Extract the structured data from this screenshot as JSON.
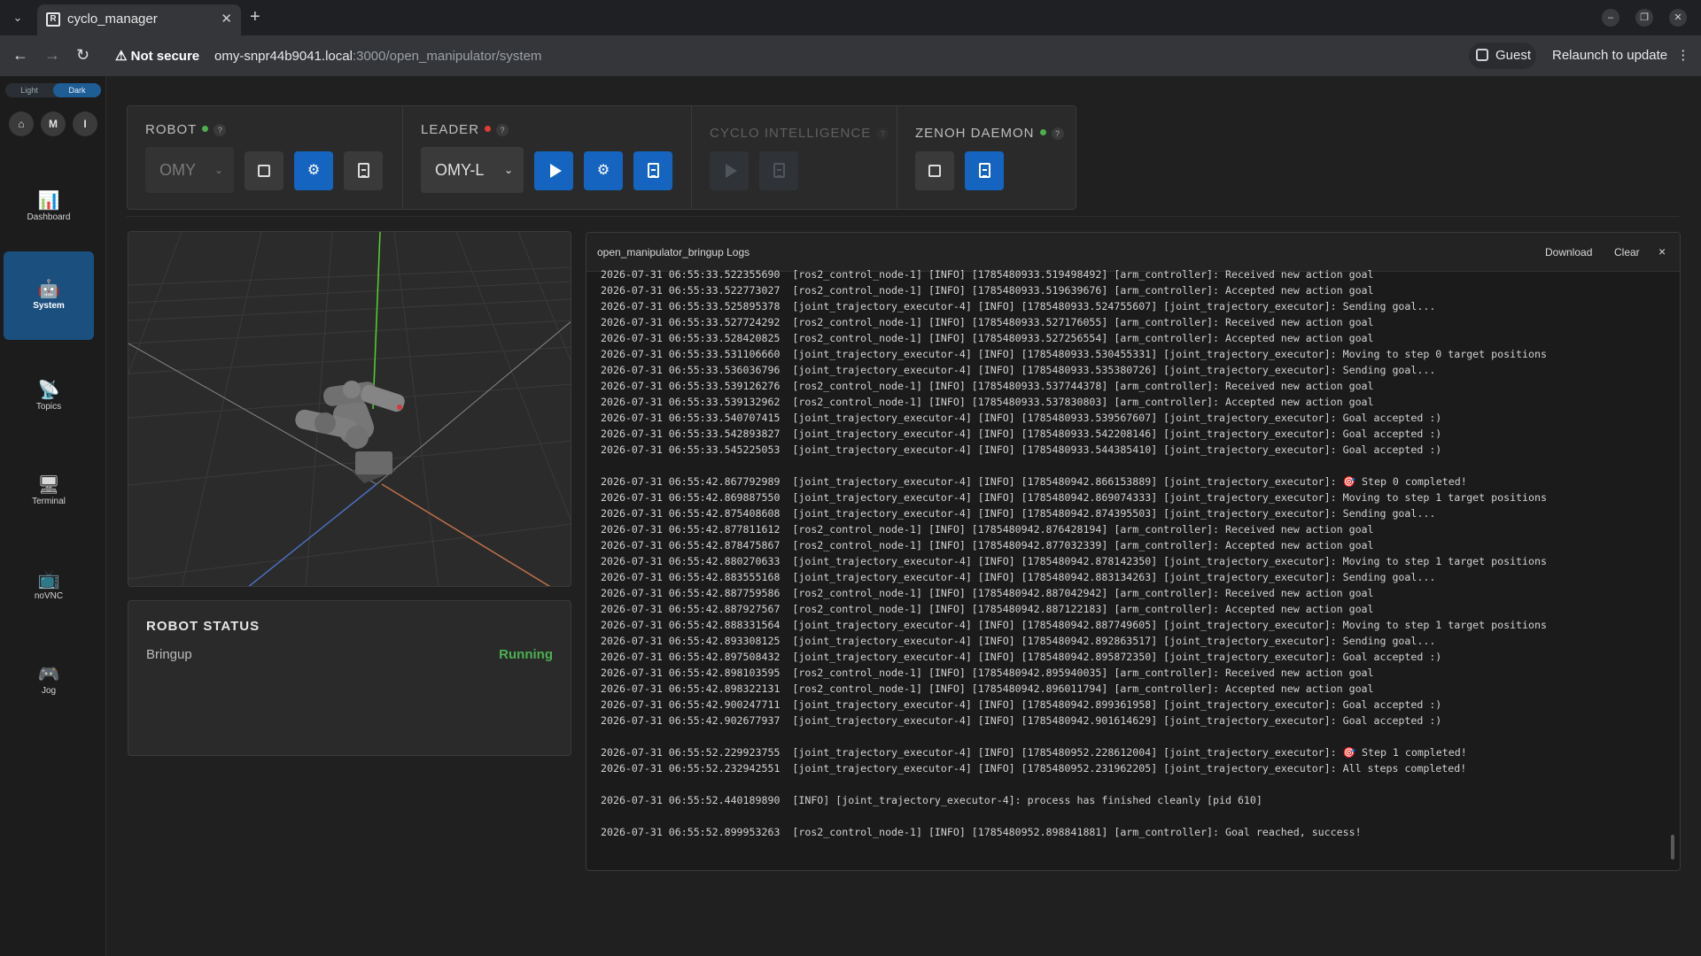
{
  "browser": {
    "tab_title": "cyclo_manager",
    "security": "Not secure",
    "url_host": "omy-snpr44b9041.local",
    "url_path": ":3000/open_manipulator/system",
    "guest_label": "Guest",
    "relaunch_label": "Relaunch to update"
  },
  "sidebar": {
    "theme": {
      "light": "Light",
      "dark": "Dark",
      "active": "Dark"
    },
    "quick": [
      "M",
      "I"
    ],
    "items": [
      {
        "label": "Dashboard",
        "icon": "📊"
      },
      {
        "label": "System",
        "icon": "🤖"
      },
      {
        "label": "Topics",
        "icon": "📡"
      },
      {
        "label": "Terminal",
        "icon": "🖥"
      },
      {
        "label": "noVNC",
        "icon": "📺"
      },
      {
        "label": "Jog",
        "icon": "🎮"
      }
    ]
  },
  "controls": {
    "robot": {
      "title": "ROBOT",
      "status_color": "#4caf50",
      "select": "OMY"
    },
    "leader": {
      "title": "LEADER",
      "status_color": "#e53935",
      "select": "OMY-L"
    },
    "cyclo": {
      "title": "CYCLO INTELLIGENCE"
    },
    "zenoh": {
      "title": "ZENOH DAEMON",
      "status_color": "#4caf50"
    },
    "help": "?"
  },
  "robot_status": {
    "title": "ROBOT STATUS",
    "key": "Bringup",
    "value": "Running",
    "value_color": "#4caf50"
  },
  "logs": {
    "title": "open_manipulator_bringup Logs",
    "download_label": "Download",
    "clear_label": "Clear",
    "close_label": "×",
    "lines": [
      "2026-07-31 06:55:33.522355690  [ros2_control_node-1] [INFO] [1785480933.519498492] [arm_controller]: Received new action goal",
      "2026-07-31 06:55:33.522773027  [ros2_control_node-1] [INFO] [1785480933.519639676] [arm_controller]: Accepted new action goal",
      "2026-07-31 06:55:33.525895378  [joint_trajectory_executor-4] [INFO] [1785480933.524755607] [joint_trajectory_executor]: Sending goal...",
      "2026-07-31 06:55:33.527724292  [ros2_control_node-1] [INFO] [1785480933.527176055] [arm_controller]: Received new action goal",
      "2026-07-31 06:55:33.528420825  [ros2_control_node-1] [INFO] [1785480933.527256554] [arm_controller]: Accepted new action goal",
      "2026-07-31 06:55:33.531106660  [joint_trajectory_executor-4] [INFO] [1785480933.530455331] [joint_trajectory_executor]: Moving to step 0 target positions",
      "2026-07-31 06:55:33.536036796  [joint_trajectory_executor-4] [INFO] [1785480933.535380726] [joint_trajectory_executor]: Sending goal...",
      "2026-07-31 06:55:33.539126276  [ros2_control_node-1] [INFO] [1785480933.537744378] [arm_controller]: Received new action goal",
      "2026-07-31 06:55:33.539132962  [ros2_control_node-1] [INFO] [1785480933.537830803] [arm_controller]: Accepted new action goal",
      "2026-07-31 06:55:33.540707415  [joint_trajectory_executor-4] [INFO] [1785480933.539567607] [joint_trajectory_executor]: Goal accepted :)",
      "2026-07-31 06:55:33.542893827  [joint_trajectory_executor-4] [INFO] [1785480933.542208146] [joint_trajectory_executor]: Goal accepted :)",
      "2026-07-31 06:55:33.545225053  [joint_trajectory_executor-4] [INFO] [1785480933.544385410] [joint_trajectory_executor]: Goal accepted :)",
      "",
      "2026-07-31 06:55:42.867792989  [joint_trajectory_executor-4] [INFO] [1785480942.866153889] [joint_trajectory_executor]: 🎯 Step 0 completed!",
      "2026-07-31 06:55:42.869887550  [joint_trajectory_executor-4] [INFO] [1785480942.869074333] [joint_trajectory_executor]: Moving to step 1 target positions",
      "2026-07-31 06:55:42.875408608  [joint_trajectory_executor-4] [INFO] [1785480942.874395503] [joint_trajectory_executor]: Sending goal...",
      "2026-07-31 06:55:42.877811612  [ros2_control_node-1] [INFO] [1785480942.876428194] [arm_controller]: Received new action goal",
      "2026-07-31 06:55:42.878475867  [ros2_control_node-1] [INFO] [1785480942.877032339] [arm_controller]: Accepted new action goal",
      "2026-07-31 06:55:42.880270633  [joint_trajectory_executor-4] [INFO] [1785480942.878142350] [joint_trajectory_executor]: Moving to step 1 target positions",
      "2026-07-31 06:55:42.883555168  [joint_trajectory_executor-4] [INFO] [1785480942.883134263] [joint_trajectory_executor]: Sending goal...",
      "2026-07-31 06:55:42.887759586  [ros2_control_node-1] [INFO] [1785480942.887042942] [arm_controller]: Received new action goal",
      "2026-07-31 06:55:42.887927567  [ros2_control_node-1] [INFO] [1785480942.887122183] [arm_controller]: Accepted new action goal",
      "2026-07-31 06:55:42.888331564  [joint_trajectory_executor-4] [INFO] [1785480942.887749605] [joint_trajectory_executor]: Moving to step 1 target positions",
      "2026-07-31 06:55:42.893308125  [joint_trajectory_executor-4] [INFO] [1785480942.892863517] [joint_trajectory_executor]: Sending goal...",
      "2026-07-31 06:55:42.897508432  [joint_trajectory_executor-4] [INFO] [1785480942.895872350] [joint_trajectory_executor]: Goal accepted :)",
      "2026-07-31 06:55:42.898103595  [ros2_control_node-1] [INFO] [1785480942.895940035] [arm_controller]: Received new action goal",
      "2026-07-31 06:55:42.898322131  [ros2_control_node-1] [INFO] [1785480942.896011794] [arm_controller]: Accepted new action goal",
      "2026-07-31 06:55:42.900247711  [joint_trajectory_executor-4] [INFO] [1785480942.899361958] [joint_trajectory_executor]: Goal accepted :)",
      "2026-07-31 06:55:42.902677937  [joint_trajectory_executor-4] [INFO] [1785480942.901614629] [joint_trajectory_executor]: Goal accepted :)",
      "",
      "2026-07-31 06:55:52.229923755  [joint_trajectory_executor-4] [INFO] [1785480952.228612004] [joint_trajectory_executor]: 🎯 Step 1 completed!",
      "2026-07-31 06:55:52.232942551  [joint_trajectory_executor-4] [INFO] [1785480952.231962205] [joint_trajectory_executor]: All steps completed!",
      "",
      "2026-07-31 06:55:52.440189890  [INFO] [joint_trajectory_executor-4]: process has finished cleanly [pid 610]",
      "",
      "2026-07-31 06:55:52.899953263  [ros2_control_node-1] [INFO] [1785480952.898841881] [arm_controller]: Goal reached, success!"
    ]
  }
}
